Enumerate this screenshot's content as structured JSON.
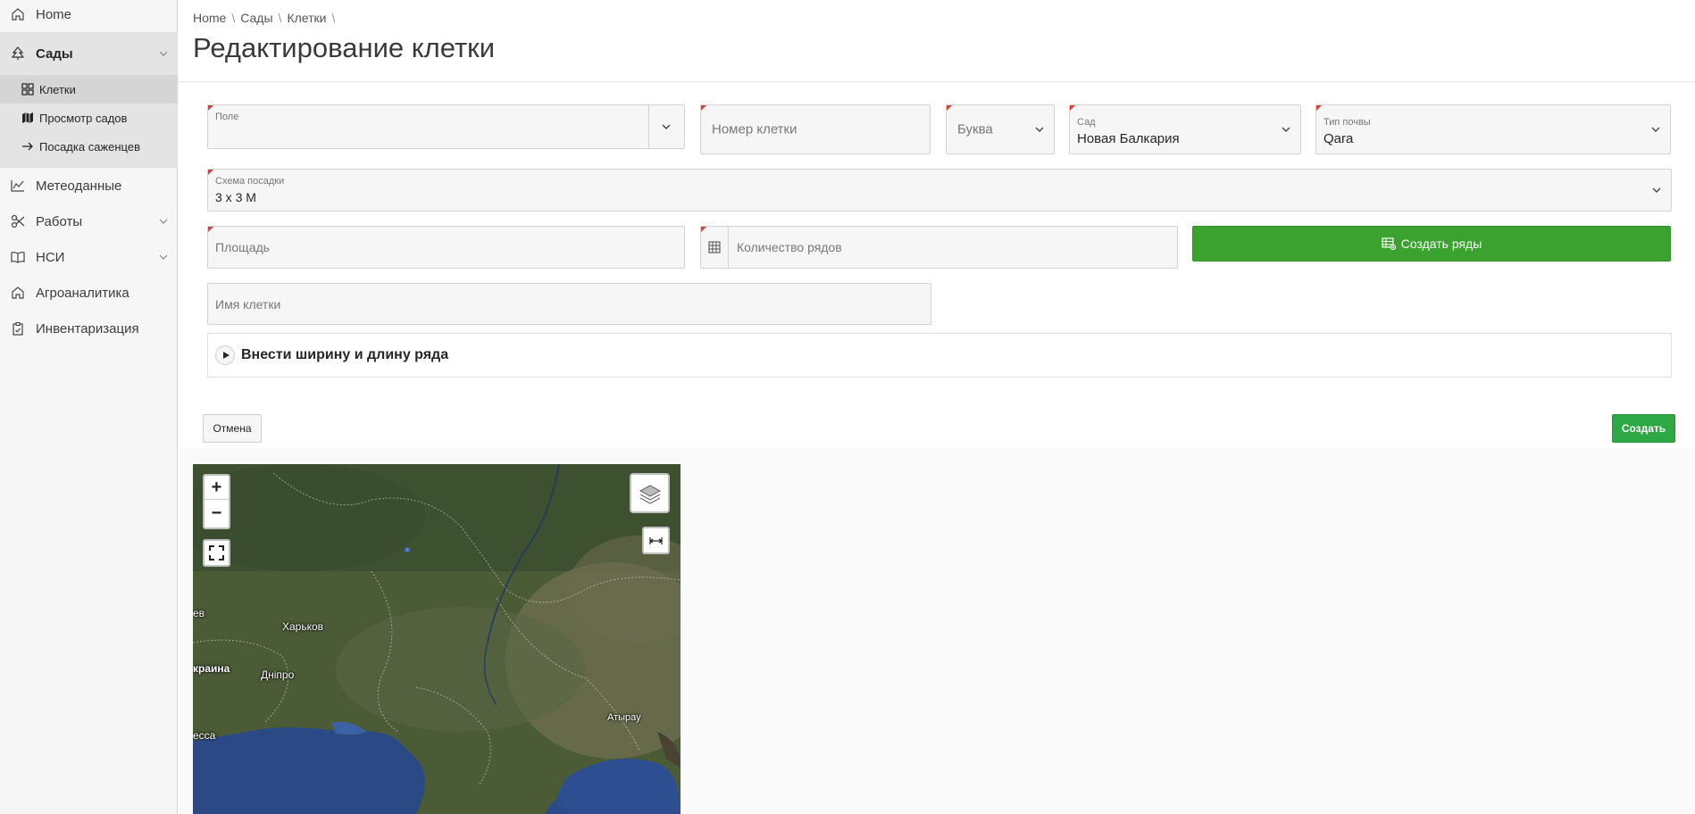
{
  "sidebar": {
    "items": [
      {
        "label": "Home",
        "icon": "home-icon"
      },
      {
        "label": "Сады",
        "icon": "tree-icon"
      },
      {
        "label": "Метеоданные",
        "icon": "chart-line-icon"
      },
      {
        "label": "Работы",
        "icon": "scissors-icon"
      },
      {
        "label": "НСИ",
        "icon": "book-icon"
      },
      {
        "label": "Агроаналитика",
        "icon": "home-icon"
      },
      {
        "label": "Инвентаризация",
        "icon": "clipboard-icon"
      }
    ],
    "subitems": [
      {
        "label": "Клетки",
        "icon": "grid-icon"
      },
      {
        "label": "Просмотр садов",
        "icon": "map-icon"
      },
      {
        "label": "Посадка саженцев",
        "icon": "arrow-right-icon"
      }
    ]
  },
  "breadcrumb": [
    "Home",
    "Сады",
    "Клетки"
  ],
  "page_title": "Редактирование клетки",
  "form": {
    "pole": {
      "label": "Поле",
      "value": ""
    },
    "nomer": {
      "placeholder": "Номер клетки"
    },
    "bukva": {
      "placeholder": "Буква"
    },
    "sad": {
      "label": "Сад",
      "value": "Новая Балкария"
    },
    "tip_pochvy": {
      "label": "Тип почвы",
      "value": "Qara"
    },
    "skhema": {
      "label": "Схема посадки",
      "value": "3 x 3 M"
    },
    "ploshchad": {
      "placeholder": "Площадь"
    },
    "kolichestvo": {
      "placeholder": "Количество рядов"
    },
    "create_rows_label": "Создать ряды",
    "imya": {
      "placeholder": "Имя клетки"
    },
    "collapsible_title": "Внести ширину и длину ряда"
  },
  "buttons": {
    "cancel": "Отмена",
    "create": "Создать"
  },
  "map": {
    "zoom_in": "+",
    "zoom_out": "−",
    "labels": [
      "Харьков",
      "Дніпро",
      "краина",
      "ев",
      "есса",
      "Атырау"
    ]
  },
  "colors": {
    "primary_green": "#3ba22f",
    "required_marker": "#e53935"
  }
}
